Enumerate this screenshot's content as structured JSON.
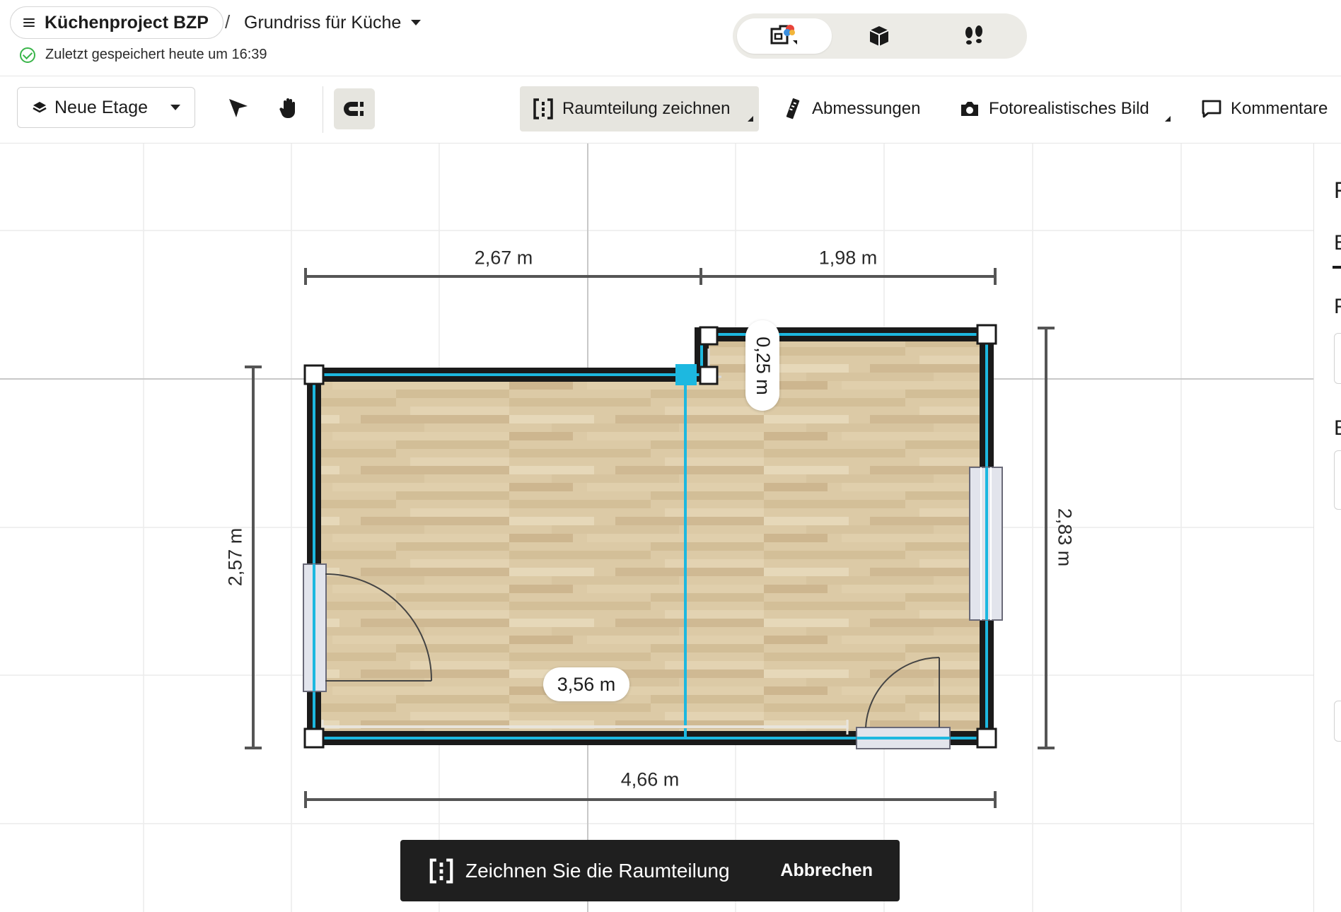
{
  "header": {
    "project_name": "Küchenproject BZP",
    "breadcrumb_separator": "/",
    "plan_name": "Grundriss für Küche",
    "save_status": "Zuletzt gespeichert heute um 16:39"
  },
  "view_modes": [
    {
      "icon": "floorplan-2d-icon",
      "active": true
    },
    {
      "icon": "3d-box-icon",
      "active": false
    },
    {
      "icon": "footsteps-walkthrough-icon",
      "active": false
    }
  ],
  "toolbar": {
    "floor_label": "Neue Etage",
    "draw_room_divider_label": "Raumteilung zeichnen",
    "dimensions_label": "Abmessungen",
    "photoreal_label": "Fotorealistisches Bild",
    "comments_label": "Kommentare"
  },
  "plan": {
    "dim_top_left": "2,67 m",
    "dim_top_right": "1,98 m",
    "dim_bottom": "4,66 m",
    "dim_left": "2,57 m",
    "dim_right": "2,83 m",
    "dim_notch": "0,25 m",
    "dim_divider_length": "3,56 m"
  },
  "right_panel": {
    "letters": [
      "F",
      "E",
      "F",
      "E"
    ]
  },
  "snackbar": {
    "message": "Zeichnen Sie die Raumteilung",
    "action": "Abbrechen"
  },
  "colors": {
    "accent_cyan": "#1db8e0",
    "wall": "#1a1a1a",
    "floor_wood": "#d9c7a2",
    "toolbar_active_bg": "#e6e5df",
    "save_ok_green": "#3ab54a"
  }
}
